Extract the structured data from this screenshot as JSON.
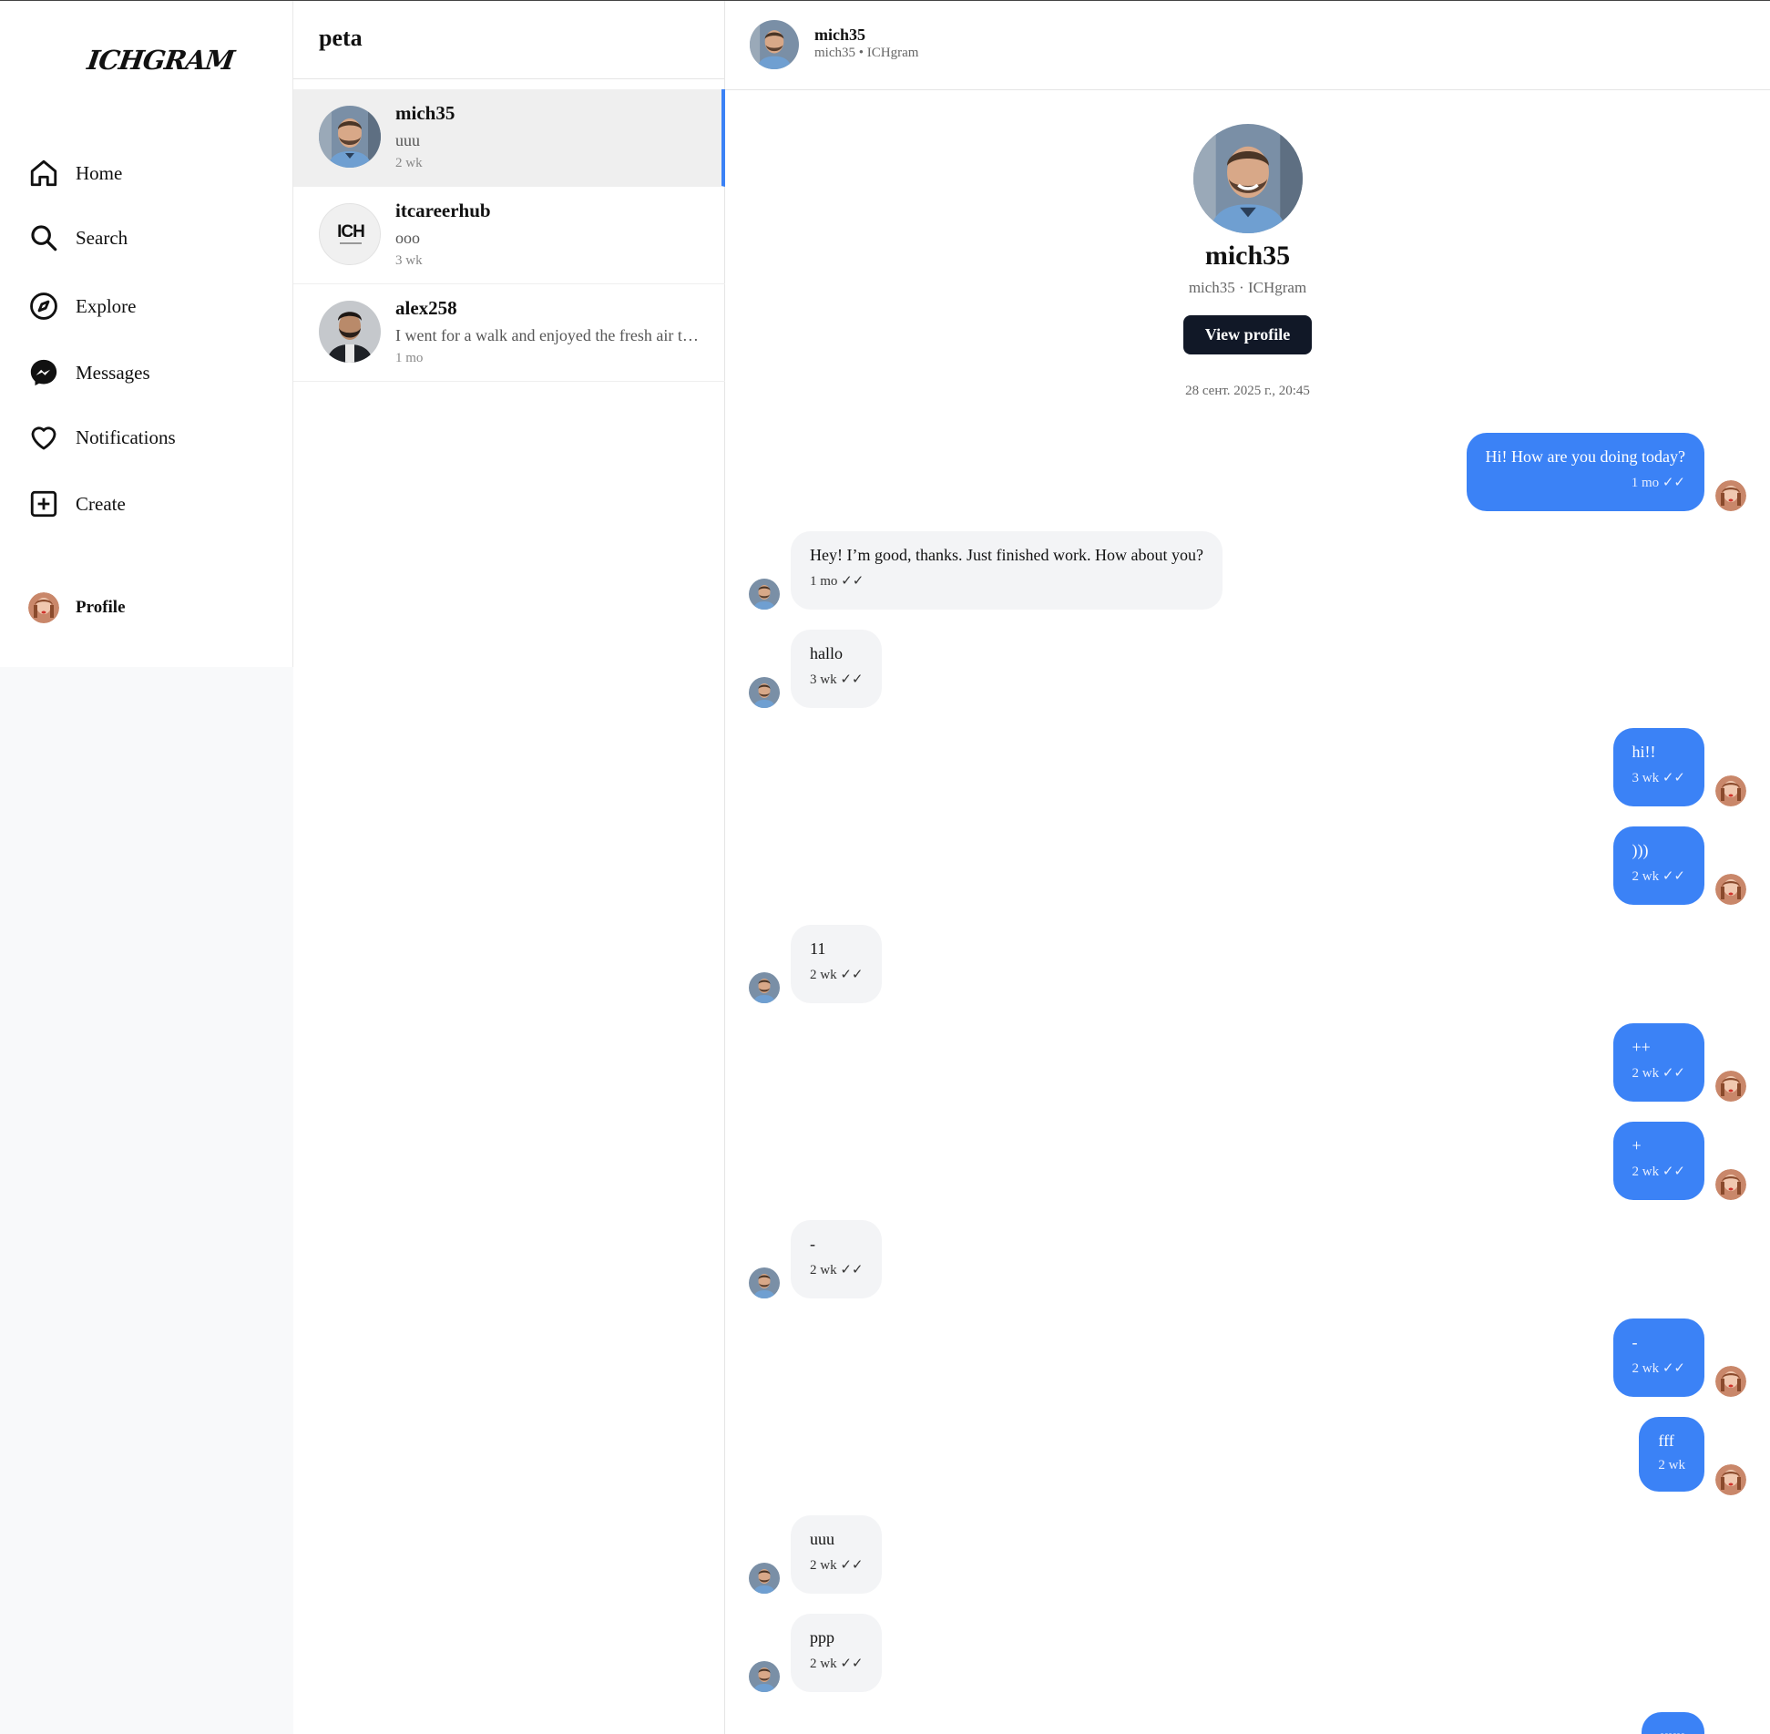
{
  "app": {
    "logo": "ICHGRAM"
  },
  "sidebar": {
    "items": [
      {
        "label": "Home",
        "icon": "home-icon"
      },
      {
        "label": "Search",
        "icon": "search-icon"
      },
      {
        "label": "Explore",
        "icon": "compass-icon"
      },
      {
        "label": "Messages",
        "icon": "messenger-icon"
      },
      {
        "label": "Notifications",
        "icon": "heart-icon"
      },
      {
        "label": "Create",
        "icon": "plus-square-icon"
      }
    ],
    "profile_label": "Profile"
  },
  "conversations": {
    "title": "peta",
    "items": [
      {
        "name": "mich35",
        "preview": "uuu",
        "time": "2 wk",
        "active": true
      },
      {
        "name": "itcareerhub",
        "preview": "ooo",
        "time": "3 wk",
        "active": false,
        "avatar_text": "ICH"
      },
      {
        "name": "alex258",
        "preview": "I went for a walk and enjoyed the fresh air today",
        "time": "1 mo",
        "active": false
      }
    ]
  },
  "chat": {
    "header": {
      "name": "mich35",
      "subtitle": "mich35 • ICHgram"
    },
    "intro": {
      "name": "mich35",
      "subtitle": "mich35 · ICHgram",
      "button": "View profile",
      "date": "28 сент. 2025 г., 20:45"
    },
    "messages": [
      {
        "from": "me",
        "text": "Hi! How are you doing today?",
        "time": "1 mo ✓✓"
      },
      {
        "from": "them",
        "text": "Hey! I’m good, thanks. Just finished work. How about you?",
        "time": "1 mo ✓✓"
      },
      {
        "from": "them",
        "text": "hallo",
        "time": "3 wk ✓✓"
      },
      {
        "from": "me",
        "text": "hi!!",
        "time": "3 wk ✓✓"
      },
      {
        "from": "me",
        "text": ")))",
        "time": "2 wk ✓✓"
      },
      {
        "from": "them",
        "text": "11",
        "time": "2 wk ✓✓"
      },
      {
        "from": "me",
        "text": "++",
        "time": "2 wk ✓✓"
      },
      {
        "from": "me",
        "text": "+",
        "time": "2 wk ✓✓"
      },
      {
        "from": "them",
        "text": "-",
        "time": "2 wk ✓✓"
      },
      {
        "from": "me",
        "text": "-",
        "time": "2 wk ✓✓"
      },
      {
        "from": "me",
        "text": "fff",
        "time": "2 wk"
      },
      {
        "from": "them",
        "text": "uuu",
        "time": "2 wk ✓✓"
      },
      {
        "from": "them",
        "text": "ppp",
        "time": "2 wk ✓✓"
      },
      {
        "from": "me",
        "text": "uuu",
        "time": ""
      }
    ]
  },
  "colors": {
    "accent": "#3b82f6",
    "button_dark": "#111827",
    "incoming_bubble": "#f3f4f6"
  }
}
